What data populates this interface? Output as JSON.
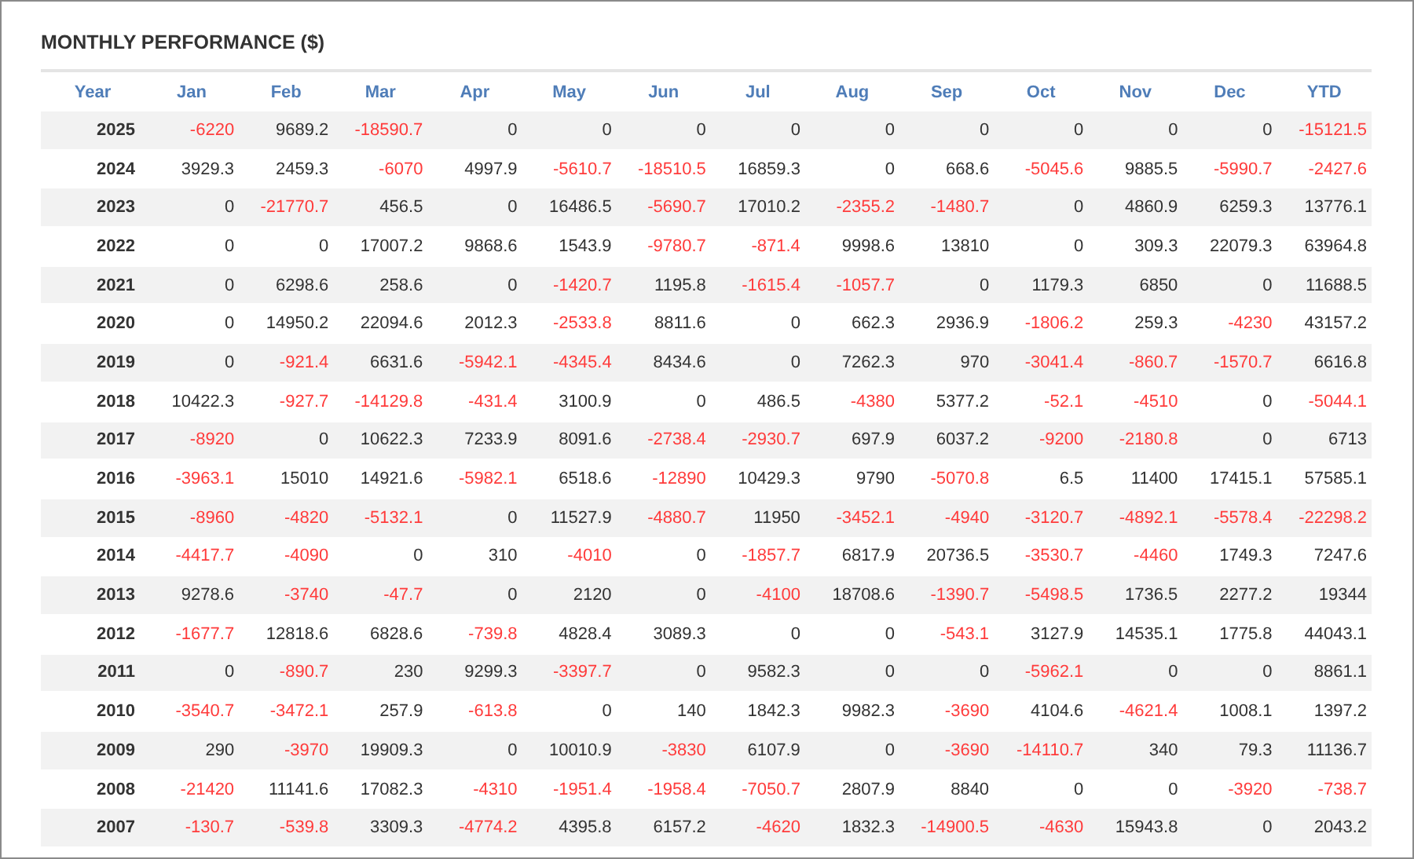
{
  "title": "MONTHLY PERFORMANCE ($)",
  "columns": [
    "Year",
    "Jan",
    "Feb",
    "Mar",
    "Apr",
    "May",
    "Jun",
    "Jul",
    "Aug",
    "Sep",
    "Oct",
    "Nov",
    "Dec",
    "YTD"
  ],
  "rows": [
    {
      "year": "2025",
      "values": [
        "-6220",
        "9689.2",
        "-18590.7",
        "0",
        "0",
        "0",
        "0",
        "0",
        "0",
        "0",
        "0",
        "0",
        "-15121.5"
      ],
      "negative": [
        true,
        false,
        true,
        false,
        false,
        false,
        false,
        false,
        false,
        false,
        false,
        false,
        true
      ]
    },
    {
      "year": "2024",
      "values": [
        "3929.3",
        "2459.3",
        "-6070",
        "4997.9",
        "-5610.7",
        "-18510.5",
        "16859.3",
        "0",
        "668.6",
        "-5045.6",
        "9885.5",
        "-5990.7",
        "-2427.6"
      ],
      "negative": [
        false,
        false,
        true,
        false,
        true,
        true,
        false,
        false,
        false,
        true,
        false,
        true,
        true
      ]
    },
    {
      "year": "2023",
      "values": [
        "0",
        "-21770.7",
        "456.5",
        "0",
        "16486.5",
        "-5690.7",
        "17010.2",
        "-2355.2",
        "-1480.7",
        "0",
        "4860.9",
        "6259.3",
        "13776.1"
      ],
      "negative": [
        false,
        true,
        false,
        false,
        false,
        true,
        false,
        true,
        true,
        false,
        false,
        false,
        false
      ]
    },
    {
      "year": "2022",
      "values": [
        "0",
        "0",
        "17007.2",
        "9868.6",
        "1543.9",
        "-9780.7",
        "-871.4",
        "9998.6",
        "13810",
        "0",
        "309.3",
        "22079.3",
        "63964.8"
      ],
      "negative": [
        false,
        false,
        false,
        false,
        false,
        true,
        true,
        false,
        false,
        false,
        false,
        false,
        false
      ]
    },
    {
      "year": "2021",
      "values": [
        "0",
        "6298.6",
        "258.6",
        "0",
        "-1420.7",
        "1195.8",
        "-1615.4",
        "-1057.7",
        "0",
        "1179.3",
        "6850",
        "0",
        "11688.5"
      ],
      "negative": [
        false,
        false,
        false,
        false,
        true,
        false,
        true,
        true,
        false,
        false,
        false,
        false,
        false
      ]
    },
    {
      "year": "2020",
      "values": [
        "0",
        "14950.2",
        "22094.6",
        "2012.3",
        "-2533.8",
        "8811.6",
        "0",
        "662.3",
        "2936.9",
        "-1806.2",
        "259.3",
        "-4230",
        "43157.2"
      ],
      "negative": [
        false,
        false,
        false,
        false,
        true,
        false,
        false,
        false,
        false,
        true,
        false,
        true,
        false
      ]
    },
    {
      "year": "2019",
      "values": [
        "0",
        "-921.4",
        "6631.6",
        "-5942.1",
        "-4345.4",
        "8434.6",
        "0",
        "7262.3",
        "970",
        "-3041.4",
        "-860.7",
        "-1570.7",
        "6616.8"
      ],
      "negative": [
        false,
        true,
        false,
        true,
        true,
        false,
        false,
        false,
        false,
        true,
        true,
        true,
        false
      ]
    },
    {
      "year": "2018",
      "values": [
        "10422.3",
        "-927.7",
        "-14129.8",
        "-431.4",
        "3100.9",
        "0",
        "486.5",
        "-4380",
        "5377.2",
        "-52.1",
        "-4510",
        "0",
        "-5044.1"
      ],
      "negative": [
        false,
        true,
        true,
        true,
        false,
        false,
        false,
        true,
        false,
        true,
        true,
        false,
        true
      ]
    },
    {
      "year": "2017",
      "values": [
        "-8920",
        "0",
        "10622.3",
        "7233.9",
        "8091.6",
        "-2738.4",
        "-2930.7",
        "697.9",
        "6037.2",
        "-9200",
        "-2180.8",
        "0",
        "6713"
      ],
      "negative": [
        true,
        false,
        false,
        false,
        false,
        true,
        true,
        false,
        false,
        true,
        true,
        false,
        false
      ]
    },
    {
      "year": "2016",
      "values": [
        "-3963.1",
        "15010",
        "14921.6",
        "-5982.1",
        "6518.6",
        "-12890",
        "10429.3",
        "9790",
        "-5070.8",
        "6.5",
        "11400",
        "17415.1",
        "57585.1"
      ],
      "negative": [
        true,
        false,
        false,
        true,
        false,
        true,
        false,
        false,
        true,
        false,
        false,
        false,
        false
      ]
    },
    {
      "year": "2015",
      "values": [
        "-8960",
        "-4820",
        "-5132.1",
        "0",
        "11527.9",
        "-4880.7",
        "11950",
        "-3452.1",
        "-4940",
        "-3120.7",
        "-4892.1",
        "-5578.4",
        "-22298.2"
      ],
      "negative": [
        true,
        true,
        true,
        false,
        false,
        true,
        false,
        true,
        true,
        true,
        true,
        true,
        true
      ]
    },
    {
      "year": "2014",
      "values": [
        "-4417.7",
        "-4090",
        "0",
        "310",
        "-4010",
        "0",
        "-1857.7",
        "6817.9",
        "20736.5",
        "-3530.7",
        "-4460",
        "1749.3",
        "7247.6"
      ],
      "negative": [
        true,
        true,
        false,
        false,
        true,
        false,
        true,
        false,
        false,
        true,
        true,
        false,
        false
      ]
    },
    {
      "year": "2013",
      "values": [
        "9278.6",
        "-3740",
        "-47.7",
        "0",
        "2120",
        "0",
        "-4100",
        "18708.6",
        "-1390.7",
        "-5498.5",
        "1736.5",
        "2277.2",
        "19344"
      ],
      "negative": [
        false,
        true,
        true,
        false,
        false,
        false,
        true,
        false,
        true,
        true,
        false,
        false,
        false
      ]
    },
    {
      "year": "2012",
      "values": [
        "-1677.7",
        "12818.6",
        "6828.6",
        "-739.8",
        "4828.4",
        "3089.3",
        "0",
        "0",
        "-543.1",
        "3127.9",
        "14535.1",
        "1775.8",
        "44043.1"
      ],
      "negative": [
        true,
        false,
        false,
        true,
        false,
        false,
        false,
        false,
        true,
        false,
        false,
        false,
        false
      ]
    },
    {
      "year": "2011",
      "values": [
        "0",
        "-890.7",
        "230",
        "9299.3",
        "-3397.7",
        "0",
        "9582.3",
        "0",
        "0",
        "-5962.1",
        "0",
        "0",
        "8861.1"
      ],
      "negative": [
        false,
        true,
        false,
        false,
        true,
        false,
        false,
        false,
        false,
        true,
        false,
        false,
        false
      ]
    },
    {
      "year": "2010",
      "values": [
        "-3540.7",
        "-3472.1",
        "257.9",
        "-613.8",
        "0",
        "140",
        "1842.3",
        "9982.3",
        "-3690",
        "4104.6",
        "-4621.4",
        "1008.1",
        "1397.2"
      ],
      "negative": [
        true,
        true,
        false,
        true,
        false,
        false,
        false,
        false,
        true,
        false,
        true,
        false,
        false
      ]
    },
    {
      "year": "2009",
      "values": [
        "290",
        "-3970",
        "19909.3",
        "0",
        "10010.9",
        "-3830",
        "6107.9",
        "0",
        "-3690",
        "-14110.7",
        "340",
        "79.3",
        "11136.7"
      ],
      "negative": [
        false,
        true,
        false,
        false,
        false,
        true,
        false,
        false,
        true,
        true,
        false,
        false,
        false
      ]
    },
    {
      "year": "2008",
      "values": [
        "-21420",
        "11141.6",
        "17082.3",
        "-4310",
        "-1951.4",
        "-1958.4",
        "-7050.7",
        "2807.9",
        "8840",
        "0",
        "0",
        "-3920",
        "-738.7"
      ],
      "negative": [
        true,
        false,
        false,
        true,
        true,
        true,
        true,
        false,
        false,
        false,
        false,
        true,
        true
      ]
    },
    {
      "year": "2007",
      "values": [
        "-130.7",
        "-539.8",
        "3309.3",
        "-4774.2",
        "4395.8",
        "6157.2",
        "-4620",
        "1832.3",
        "-14900.5",
        "-4630",
        "15943.8",
        "0",
        "2043.2"
      ],
      "negative": [
        true,
        true,
        false,
        true,
        false,
        false,
        true,
        false,
        true,
        true,
        false,
        false,
        false
      ]
    }
  ]
}
